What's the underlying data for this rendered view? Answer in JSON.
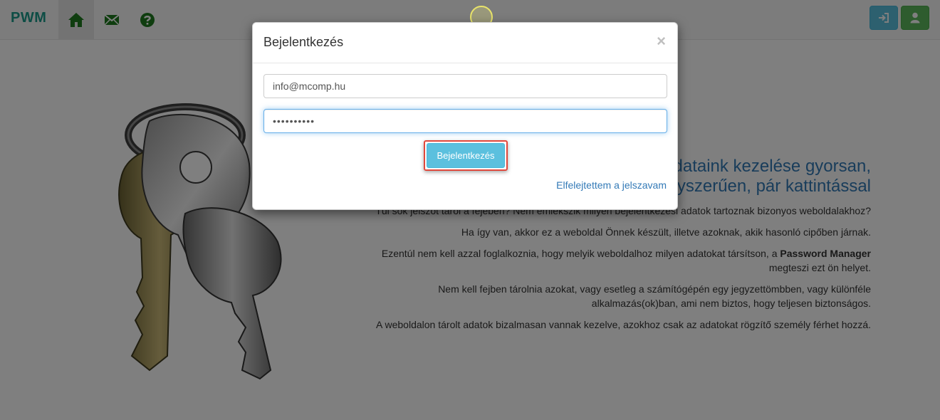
{
  "navbar": {
    "brand": "PWM",
    "items": [
      {
        "icon": "home-icon"
      },
      {
        "icon": "mail-icon"
      },
      {
        "icon": "help-icon"
      }
    ],
    "right_buttons": [
      {
        "icon": "sign-in-icon",
        "color": "#5bc0de"
      },
      {
        "icon": "user-icon",
        "color": "#5cb85c"
      }
    ]
  },
  "content": {
    "headline_line1": "Adataink kezelése gyorsan,",
    "headline_line2": "egyszerűen, pár kattintással",
    "p1": "Túl sok jelszót tárol a fejében? Nem emlékszik milyen bejelentkezési adatok tartoznak bizonyos weboldalakhoz?",
    "p2": "Ha így van, akkor ez a weboldal Önnek készült, illetve azoknak, akik hasonló cipőben járnak.",
    "p3_before": "Ezentúl nem kell azzal foglalkoznia, hogy melyik weboldalhoz milyen adatokat társítson, a ",
    "p3_bold": "Password Manager",
    "p3_after": "megteszi ezt ön helyet.",
    "p4_line1": "Nem kell fejben tárolnia azokat, vagy esetleg a számítógépén egy jegyzettömbben, vagy különféle",
    "p4_line2": "alkalmazás(ok)ban, ami nem biztos, hogy teljesen biztonságos.",
    "p5": "A weboldalon tárolt adatok bizalmasan vannak kezelve, azokhoz csak az adatokat rögzítő személy férhet hozzá."
  },
  "modal": {
    "title": "Bejelentkezés",
    "close_label": "×",
    "email_value": "info@mcomp.hu",
    "password_value": "••••••••••",
    "login_button": "Bejelentkezés",
    "forgot_link": "Elfelejtettem a jelszavam"
  },
  "colors": {
    "brand": "#1a9a8a",
    "accent_blue": "#5bc0de",
    "accent_green": "#5cb85c",
    "link": "#337ab7"
  }
}
